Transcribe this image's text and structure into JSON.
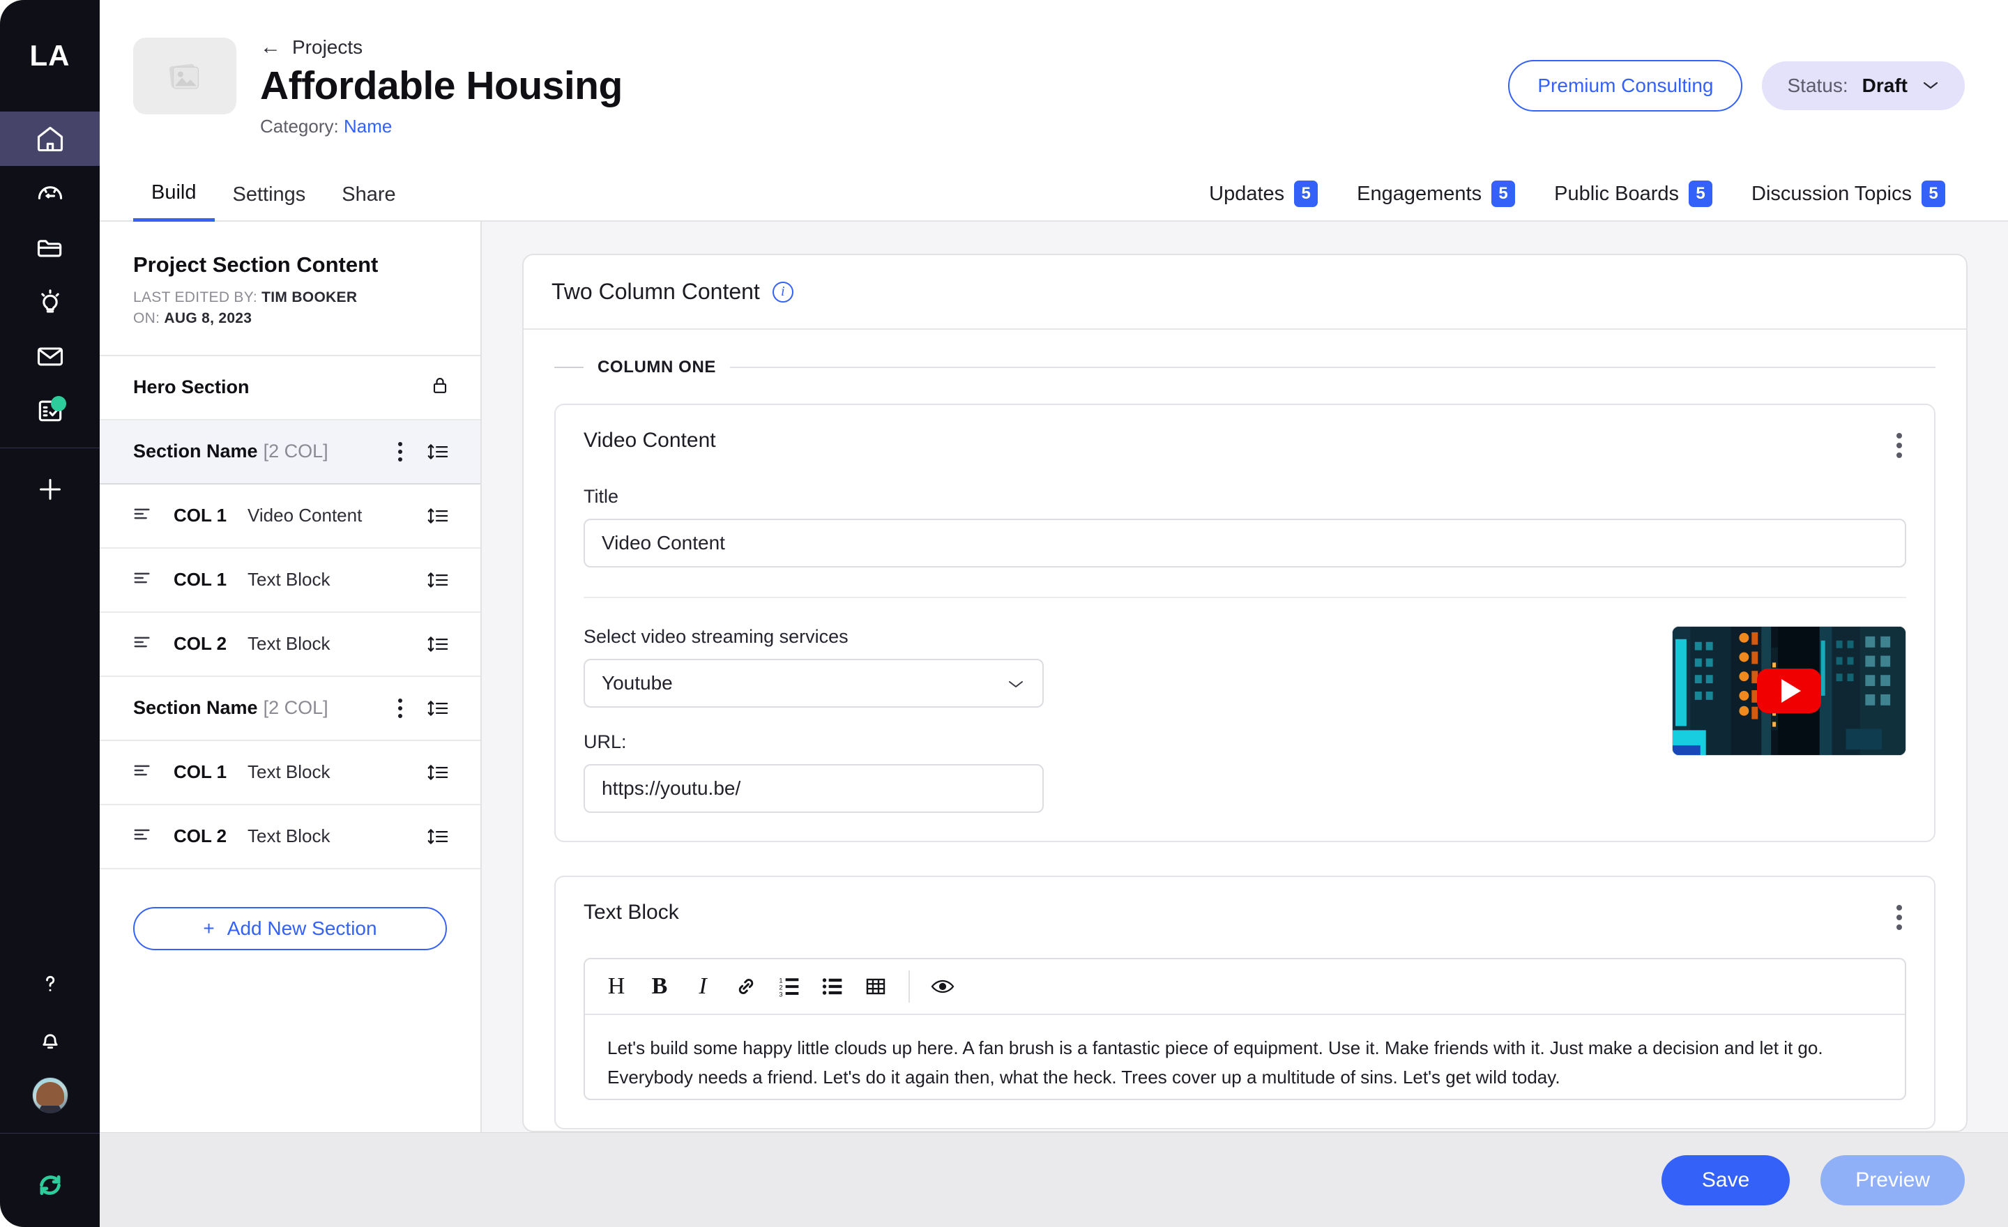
{
  "rail": {
    "logo": "LA",
    "items": [
      {
        "name": "home-icon",
        "label": "Home",
        "active": true,
        "badge": false
      },
      {
        "name": "dashboard-icon",
        "label": "Dashboard",
        "active": false,
        "badge": false
      },
      {
        "name": "folder-icon",
        "label": "Files",
        "active": false,
        "badge": false
      },
      {
        "name": "lightbulb-icon",
        "label": "Ideas",
        "active": false,
        "badge": false
      },
      {
        "name": "mail-icon",
        "label": "Messages",
        "active": false,
        "badge": false
      },
      {
        "name": "clipboard-check-icon",
        "label": "Tasks",
        "active": false,
        "badge": true
      }
    ],
    "add_label": "+",
    "bottom": [
      {
        "name": "help-icon",
        "label": "Help"
      },
      {
        "name": "bell-icon",
        "label": "Notifications"
      },
      {
        "name": "avatar",
        "label": "Account"
      }
    ],
    "sync": {
      "name": "sync-icon",
      "label": "Sync",
      "color": "#2ecc9b"
    }
  },
  "header": {
    "breadcrumb": "Projects",
    "back_arrow": "←",
    "title": "Affordable Housing",
    "category_label": "Category:",
    "category_value": "Name",
    "thumb_icon": "image-placeholder-icon",
    "premium_button": "Premium Consulting",
    "status_label": "Status:",
    "status_value": "Draft",
    "status_chevron": "⌄"
  },
  "tabs": {
    "left": [
      {
        "label": "Build",
        "active": true
      },
      {
        "label": "Settings",
        "active": false
      },
      {
        "label": "Share",
        "active": false
      }
    ],
    "right": [
      {
        "label": "Updates",
        "count": "5"
      },
      {
        "label": "Engagements",
        "count": "5"
      },
      {
        "label": "Public Boards",
        "count": "5"
      },
      {
        "label": "Discussion Topics",
        "count": "5"
      }
    ]
  },
  "panel": {
    "title": "Project Section Content",
    "edited_prefix": "LAST EDITED BY:",
    "edited_by": "TIM BOOKER",
    "on_prefix": "ON:",
    "on_date": "AUG 8, 2023",
    "rows": [
      {
        "kind": "section",
        "name": "Hero Section",
        "tag": "",
        "locked": true,
        "selected": false
      },
      {
        "kind": "section",
        "name": "Section Name",
        "tag": "[2 COL]",
        "locked": false,
        "selected": true
      },
      {
        "kind": "block",
        "col": "COL 1",
        "type": "Video Content"
      },
      {
        "kind": "block",
        "col": "COL 1",
        "type": "Text Block"
      },
      {
        "kind": "block",
        "col": "COL 2",
        "type": "Text Block"
      },
      {
        "kind": "section",
        "name": "Section Name",
        "tag": "[2 COL]",
        "locked": false,
        "selected": false
      },
      {
        "kind": "block",
        "col": "COL 1",
        "type": "Text Block"
      },
      {
        "kind": "block",
        "col": "COL 2",
        "type": "Text Block"
      }
    ],
    "add_section": "Add New Section",
    "add_plus": "+"
  },
  "card": {
    "title": "Two Column Content",
    "info_glyph": "i",
    "column_label": "COLUMN ONE",
    "video_block": {
      "title": "Video Content",
      "title_field_label": "Title",
      "title_field_value": "Video Content",
      "service_label": "Select video streaming services",
      "service_value": "Youtube",
      "service_chevron": "⌄",
      "url_label": "URL:",
      "url_value": "https://youtu.be/",
      "thumb_alt": "youtube-video-thumbnail",
      "play_icon": "play-icon"
    },
    "text_block": {
      "title": "Text Block",
      "toolbar": [
        {
          "name": "heading-icon",
          "glyph": "H"
        },
        {
          "name": "bold-icon",
          "glyph": "B"
        },
        {
          "name": "italic-icon",
          "glyph": "I"
        },
        {
          "name": "link-icon",
          "glyph": "🔗"
        },
        {
          "name": "ordered-list-icon",
          "glyph": ""
        },
        {
          "name": "bullet-list-icon",
          "glyph": ""
        },
        {
          "name": "table-icon",
          "glyph": ""
        },
        {
          "name": "preview-eye-icon",
          "glyph": ""
        }
      ],
      "content": "Let's build some happy little clouds up here. A fan brush is a fantastic piece of equipment. Use it. Make friends with it. Just make a decision and let it go. Everybody needs a friend. Let's do it again then, what the heck. Trees cover up a multitude of sins. Let's get wild today."
    }
  },
  "footer": {
    "save": "Save",
    "preview": "Preview"
  },
  "colors": {
    "accent": "#3461f7",
    "rail_bg": "#0f0f17",
    "rail_active": "#474469",
    "badge_green": "#2ecc9b",
    "canvas_bg": "#f5f5f7",
    "footer_bg": "#eaeaec",
    "status_pill_bg": "#e3e2fa",
    "youtube_red": "#f00000"
  }
}
